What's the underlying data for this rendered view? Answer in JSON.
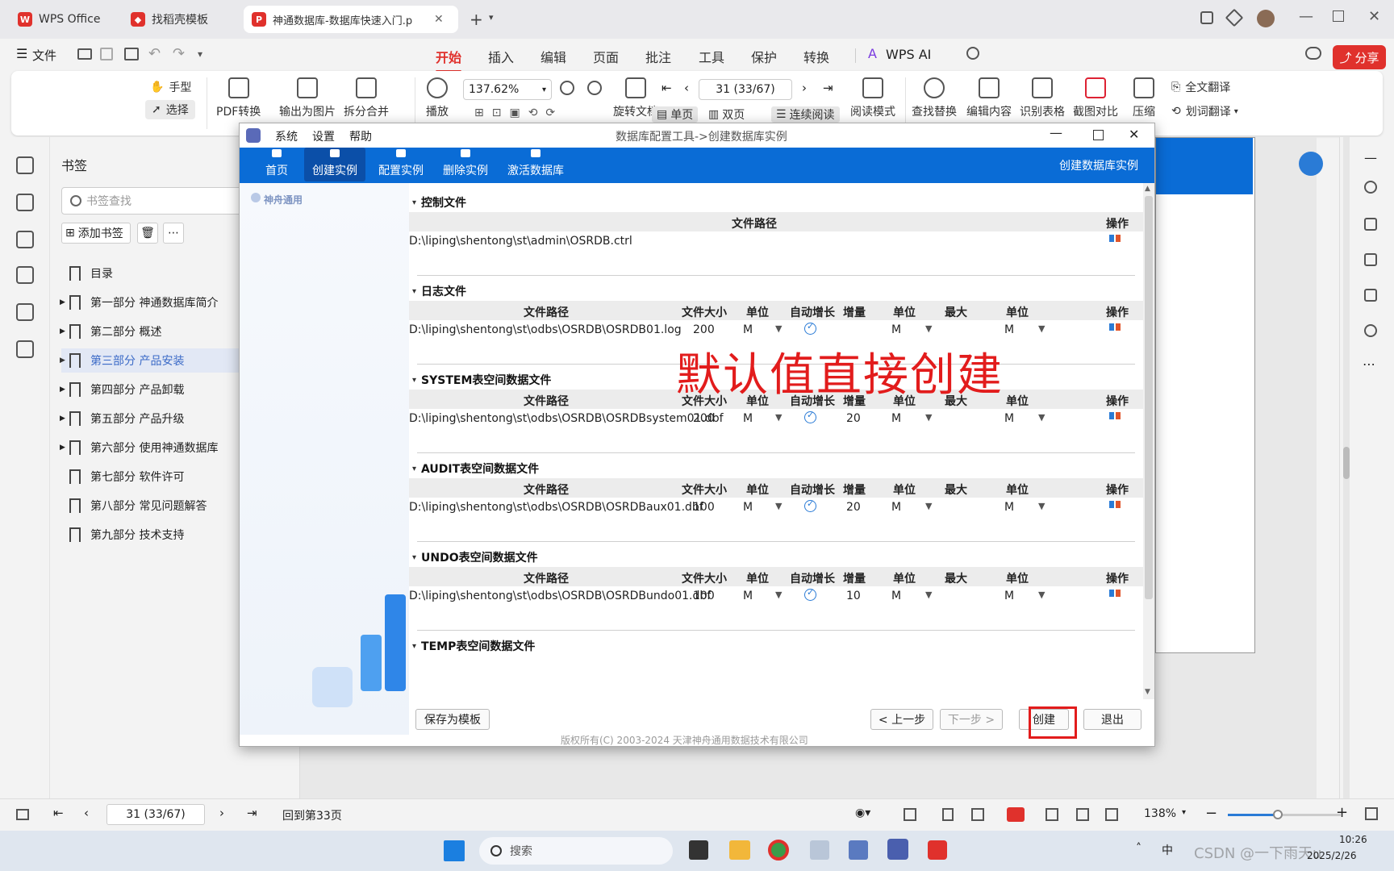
{
  "tabs": [
    {
      "label": "WPS Office"
    },
    {
      "label": "找稻壳模板"
    },
    {
      "label": "神通数据库-数据库快速入门.p"
    }
  ],
  "menu": {
    "file": "文件",
    "items": [
      "开始",
      "插入",
      "编辑",
      "页面",
      "批注",
      "工具",
      "保护",
      "转换"
    ],
    "ai": "WPS AI",
    "share": "分享"
  },
  "ribbon": {
    "hand": "手型",
    "select": "选择",
    "pdf_convert": "PDF转换",
    "export_image": "输出为图片",
    "split_merge": "拆分合并",
    "play": "播放",
    "zoom": "137.62%",
    "page_input": "31 (33/67)",
    "rotate": "旋转文档",
    "single": "单页",
    "double": "双页",
    "continuous": "连续阅读",
    "read_mode": "阅读模式",
    "find_replace": "查找替换",
    "edit_content": "编辑内容",
    "recognize_table": "识别表格",
    "screenshot_compare": "截图对比",
    "compress": "压缩",
    "full_translate": "全文翻译",
    "word_translate": "划词翻译"
  },
  "bookmarks": {
    "title": "书签",
    "search_placeholder": "书签查找",
    "add": "添加书签",
    "items": [
      {
        "label": "目录"
      },
      {
        "label": "第一部分 神通数据库简介"
      },
      {
        "label": "第二部分 概述"
      },
      {
        "label": "第三部分 产品安装"
      },
      {
        "label": "第四部分 产品卸载"
      },
      {
        "label": "第五部分 产品升级"
      },
      {
        "label": "第六部分 使用神通数据库"
      },
      {
        "label": "第七部分 软件许可"
      },
      {
        "label": "第八部分 常见问题解答"
      },
      {
        "label": "第九部分 技术支持"
      }
    ]
  },
  "dialog": {
    "title": "数据库配置工具->创建数据库实例",
    "menus": [
      "系统",
      "设置",
      "帮助"
    ],
    "nav": [
      "首页",
      "创建实例",
      "配置实例",
      "删除实例",
      "激活数据库"
    ],
    "nav_right": "创建数据库实例",
    "logo": "神舟通用",
    "sections": {
      "control": "控制文件",
      "log": "日志文件",
      "system": "SYSTEM表空间数据文件",
      "audit": "AUDIT表空间数据文件",
      "undo": "UNDO表空间数据文件",
      "temp": "TEMP表空间数据文件"
    },
    "headers": {
      "path": "文件路径",
      "size": "文件大小",
      "unit": "单位",
      "autogrow": "自动增长",
      "inc": "增量",
      "max": "最大",
      "op": "操作"
    },
    "rows": {
      "control": {
        "path": "D:\\liping\\shentong\\st\\admin\\OSRDB.ctrl"
      },
      "log": {
        "path": "D:\\liping\\shentong\\st\\odbs\\OSRDB\\OSRDB01.log",
        "size": "200",
        "unit": "M",
        "inc": "",
        "inc_unit": "M",
        "max_unit": "M"
      },
      "system": {
        "path": "D:\\liping\\shentong\\st\\odbs\\OSRDB\\OSRDBsystem01.dbf",
        "size": "200",
        "unit": "M",
        "inc": "20",
        "inc_unit": "M",
        "max_unit": "M"
      },
      "audit": {
        "path": "D:\\liping\\shentong\\st\\odbs\\OSRDB\\OSRDBaux01.dbf",
        "size": "100",
        "unit": "M",
        "inc": "20",
        "inc_unit": "M",
        "max_unit": "M"
      },
      "undo": {
        "path": "D:\\liping\\shentong\\st\\odbs\\OSRDB\\OSRDBundo01.dbf",
        "size": "100",
        "unit": "M",
        "inc": "10",
        "inc_unit": "M",
        "max_unit": "M"
      }
    },
    "buttons": {
      "save_template": "保存为模板",
      "prev": "< 上一步",
      "next": "下一步 >",
      "create": "创建",
      "exit": "退出"
    },
    "copyright": "版权所有(C) 2003-2024 天津神舟通用数据技术有限公司"
  },
  "annotation": "默认值直接创建",
  "status": {
    "page": "31 (33/67)",
    "back": "回到第33页",
    "zoom": "138%"
  },
  "taskbar": {
    "search": "搜索",
    "time": "10:26",
    "date": "2025/2/26",
    "watermark": "CSDN @一下雨天u"
  },
  "colors": {
    "accent": "#e0312c",
    "nav_blue": "#0a6cd6",
    "annotation": "#e21c1c"
  }
}
